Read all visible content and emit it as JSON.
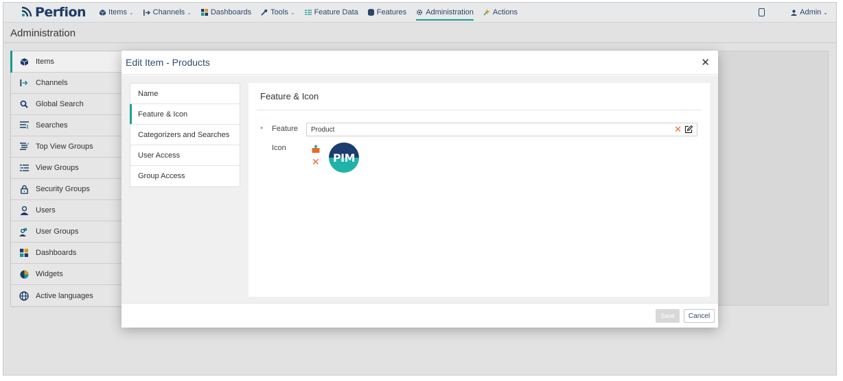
{
  "app": {
    "brand": "Perfion"
  },
  "nav": {
    "items": [
      {
        "label": "Items",
        "icon": "cube-icon",
        "has_menu": true
      },
      {
        "label": "Channels",
        "icon": "channel-arrow-icon",
        "has_menu": true
      },
      {
        "label": "Dashboards",
        "icon": "dashboard-grid-icon",
        "has_menu": false
      },
      {
        "label": "Tools",
        "icon": "wrench-icon",
        "has_menu": true
      },
      {
        "label": "Feature Data",
        "icon": "list-icon",
        "has_menu": false
      },
      {
        "label": "Features",
        "icon": "database-icon",
        "has_menu": false
      },
      {
        "label": "Administration",
        "icon": "gear-icon",
        "has_menu": false,
        "active": true
      },
      {
        "label": "Actions",
        "icon": "sparkle-icon",
        "has_menu": false
      }
    ],
    "user": "Admin"
  },
  "page": {
    "title": "Administration"
  },
  "sidebar": {
    "items": [
      {
        "label": "Items",
        "icon": "cube-icon"
      },
      {
        "label": "Channels",
        "icon": "channel-arrow-icon"
      },
      {
        "label": "Global Search",
        "icon": "search-icon"
      },
      {
        "label": "Searches",
        "icon": "searches-list-icon"
      },
      {
        "label": "Top View Groups",
        "icon": "top-view-groups-icon"
      },
      {
        "label": "View Groups",
        "icon": "view-groups-icon"
      },
      {
        "label": "Security Groups",
        "icon": "lock-icon"
      },
      {
        "label": "Users",
        "icon": "user-icon"
      },
      {
        "label": "User Groups",
        "icon": "user-groups-icon"
      },
      {
        "label": "Dashboards",
        "icon": "dashboard-grid-icon"
      },
      {
        "label": "Widgets",
        "icon": "pie-chart-icon"
      },
      {
        "label": "Active languages",
        "icon": "globe-icon"
      }
    ]
  },
  "modal": {
    "title": "Edit Item - Products",
    "tabs": [
      {
        "label": "Name"
      },
      {
        "label": "Feature & Icon"
      },
      {
        "label": "Categorizers and Searches"
      },
      {
        "label": "User Access"
      },
      {
        "label": "Group Access"
      }
    ],
    "section_title": "Feature & Icon",
    "feature_label": "Feature",
    "feature_value": "Product",
    "required_mark": "*",
    "icon_label": "Icon",
    "icon_text": "PIM",
    "save_label": "Save",
    "cancel_label": "Cancel"
  },
  "colors": {
    "accent": "#1aa39a",
    "brand": "#1f3f6d",
    "remove": "#ea6a24"
  }
}
